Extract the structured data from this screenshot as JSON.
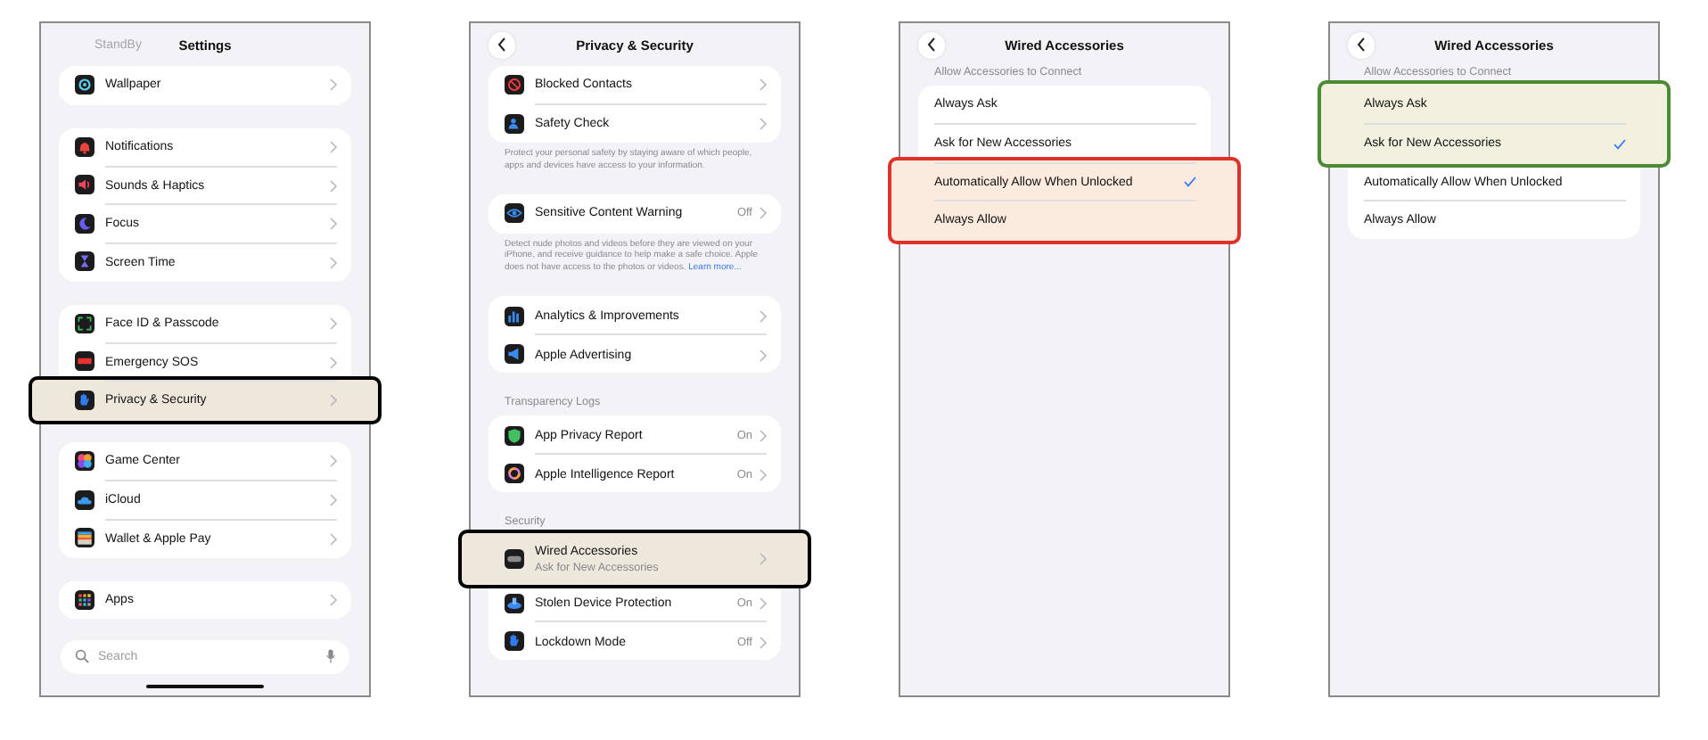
{
  "panels": [
    {
      "title": "Settings",
      "back_button": false,
      "under_header": "StandBy",
      "highlight": {
        "color": "#000000"
      },
      "sections": [
        {
          "rows": [
            {
              "kind": "nav",
              "label": "Wallpaper",
              "highlighted": false
            }
          ]
        },
        {
          "rows": [
            {
              "kind": "nav",
              "label": "Notifications",
              "highlighted": false
            },
            {
              "kind": "nav",
              "label": "Sounds & Haptics",
              "highlighted": false
            },
            {
              "kind": "nav",
              "label": "Focus",
              "highlighted": false
            },
            {
              "kind": "nav",
              "label": "Screen Time",
              "highlighted": false
            }
          ]
        },
        {
          "rows": [
            {
              "kind": "nav",
              "label": "Face ID & Passcode",
              "highlighted": false
            },
            {
              "kind": "nav",
              "label": "Emergency SOS",
              "highlighted": false
            },
            {
              "kind": "nav",
              "label": "Privacy & Security",
              "highlighted": true
            }
          ]
        },
        {
          "rows": [
            {
              "kind": "nav",
              "label": "Game Center",
              "highlighted": false
            },
            {
              "kind": "nav",
              "label": "iCloud",
              "highlighted": false
            },
            {
              "kind": "nav",
              "label": "Wallet & Apple Pay",
              "highlighted": false
            }
          ]
        },
        {
          "rows": [
            {
              "kind": "nav",
              "label": "Apps",
              "highlighted": false
            }
          ]
        }
      ],
      "search": {
        "placeholder": "Search"
      }
    },
    {
      "title": "Privacy & Security",
      "back_button": true,
      "highlight": {
        "color": "#000000"
      },
      "sections": [
        {
          "rows": [
            {
              "kind": "nav",
              "label": "Blocked Contacts",
              "highlighted": false
            },
            {
              "kind": "nav",
              "label": "Safety Check",
              "highlighted": false
            }
          ],
          "footer": {
            "text": "Protect your personal safety by staying aware of which people, apps and devices have access to your information."
          }
        },
        {
          "rows": [
            {
              "kind": "nav",
              "label": "Sensitive Content Warning",
              "value": "Off",
              "highlighted": false
            }
          ],
          "footer": {
            "text": "Detect nude photos and videos before they are viewed on your iPhone, and receive guidance to help make a safe choice. Apple does not have access to the photos or videos.",
            "link": "Learn more..."
          }
        },
        {
          "rows": [
            {
              "kind": "nav",
              "label": "Analytics & Improvements",
              "highlighted": false
            },
            {
              "kind": "nav",
              "label": "Apple Advertising",
              "highlighted": false
            }
          ]
        },
        {
          "header": "Transparency Logs",
          "rows": [
            {
              "kind": "nav",
              "label": "App Privacy Report",
              "value": "On",
              "highlighted": false
            },
            {
              "kind": "nav",
              "label": "Apple Intelligence Report",
              "value": "On",
              "highlighted": false
            }
          ]
        },
        {
          "header": "Security",
          "rows": [
            {
              "kind": "nav",
              "label": "Wired Accessories",
              "subtitle": "Ask for New Accessories",
              "highlighted": true
            },
            {
              "kind": "nav",
              "label": "Stolen Device Protection",
              "value": "On",
              "highlighted": false
            },
            {
              "kind": "nav",
              "label": "Lockdown Mode",
              "value": "Off",
              "highlighted": false
            }
          ]
        }
      ]
    },
    {
      "title": "Wired Accessories",
      "back_button": true,
      "highlight": {
        "color": "#e0302a"
      },
      "sections": [
        {
          "header": "Allow Accessories to Connect",
          "rows": [
            {
              "kind": "option",
              "label": "Always Ask",
              "checked": false,
              "highlighted": false
            },
            {
              "kind": "option",
              "label": "Ask for New Accessories",
              "checked": false,
              "highlighted": false
            },
            {
              "kind": "option",
              "label": "Automatically Allow When Unlocked",
              "checked": true,
              "highlighted": true
            },
            {
              "kind": "option",
              "label": "Always Allow",
              "checked": false,
              "highlighted": true
            }
          ]
        }
      ]
    },
    {
      "title": "Wired Accessories",
      "back_button": true,
      "highlight": {
        "color": "#4c8a34"
      },
      "sections": [
        {
          "header": "Allow Accessories to Connect",
          "rows": [
            {
              "kind": "option",
              "label": "Always Ask",
              "checked": false,
              "highlighted": true
            },
            {
              "kind": "option",
              "label": "Ask for New Accessories",
              "checked": true,
              "highlighted": true
            },
            {
              "kind": "option",
              "label": "Automatically Allow When Unlocked",
              "checked": false,
              "highlighted": false
            },
            {
              "kind": "option",
              "label": "Always Allow",
              "checked": false,
              "highlighted": false
            }
          ]
        }
      ]
    }
  ]
}
